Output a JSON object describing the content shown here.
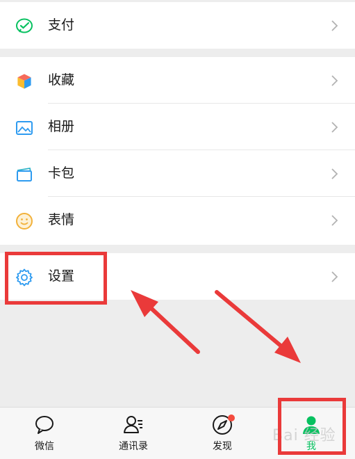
{
  "menu": {
    "pay": {
      "label": "支付",
      "icon": "wechat-pay-icon"
    },
    "favorites": {
      "label": "收藏",
      "icon": "cube-icon"
    },
    "album": {
      "label": "相册",
      "icon": "picture-icon"
    },
    "cards": {
      "label": "卡包",
      "icon": "card-icon"
    },
    "stickers": {
      "label": "表情",
      "icon": "smiley-icon"
    },
    "settings": {
      "label": "设置",
      "icon": "gear-icon"
    }
  },
  "tabbar": {
    "chats": {
      "label": "微信",
      "icon": "chat-bubble-icon"
    },
    "contacts": {
      "label": "通讯录",
      "icon": "contacts-icon"
    },
    "discover": {
      "label": "发现",
      "icon": "compass-icon"
    },
    "me": {
      "label": "我",
      "icon": "person-icon"
    }
  },
  "watermark": "Bai 经验",
  "colors": {
    "accent": "#07c160",
    "annotation": "#ea3a3a",
    "badge": "#f44b3e"
  }
}
